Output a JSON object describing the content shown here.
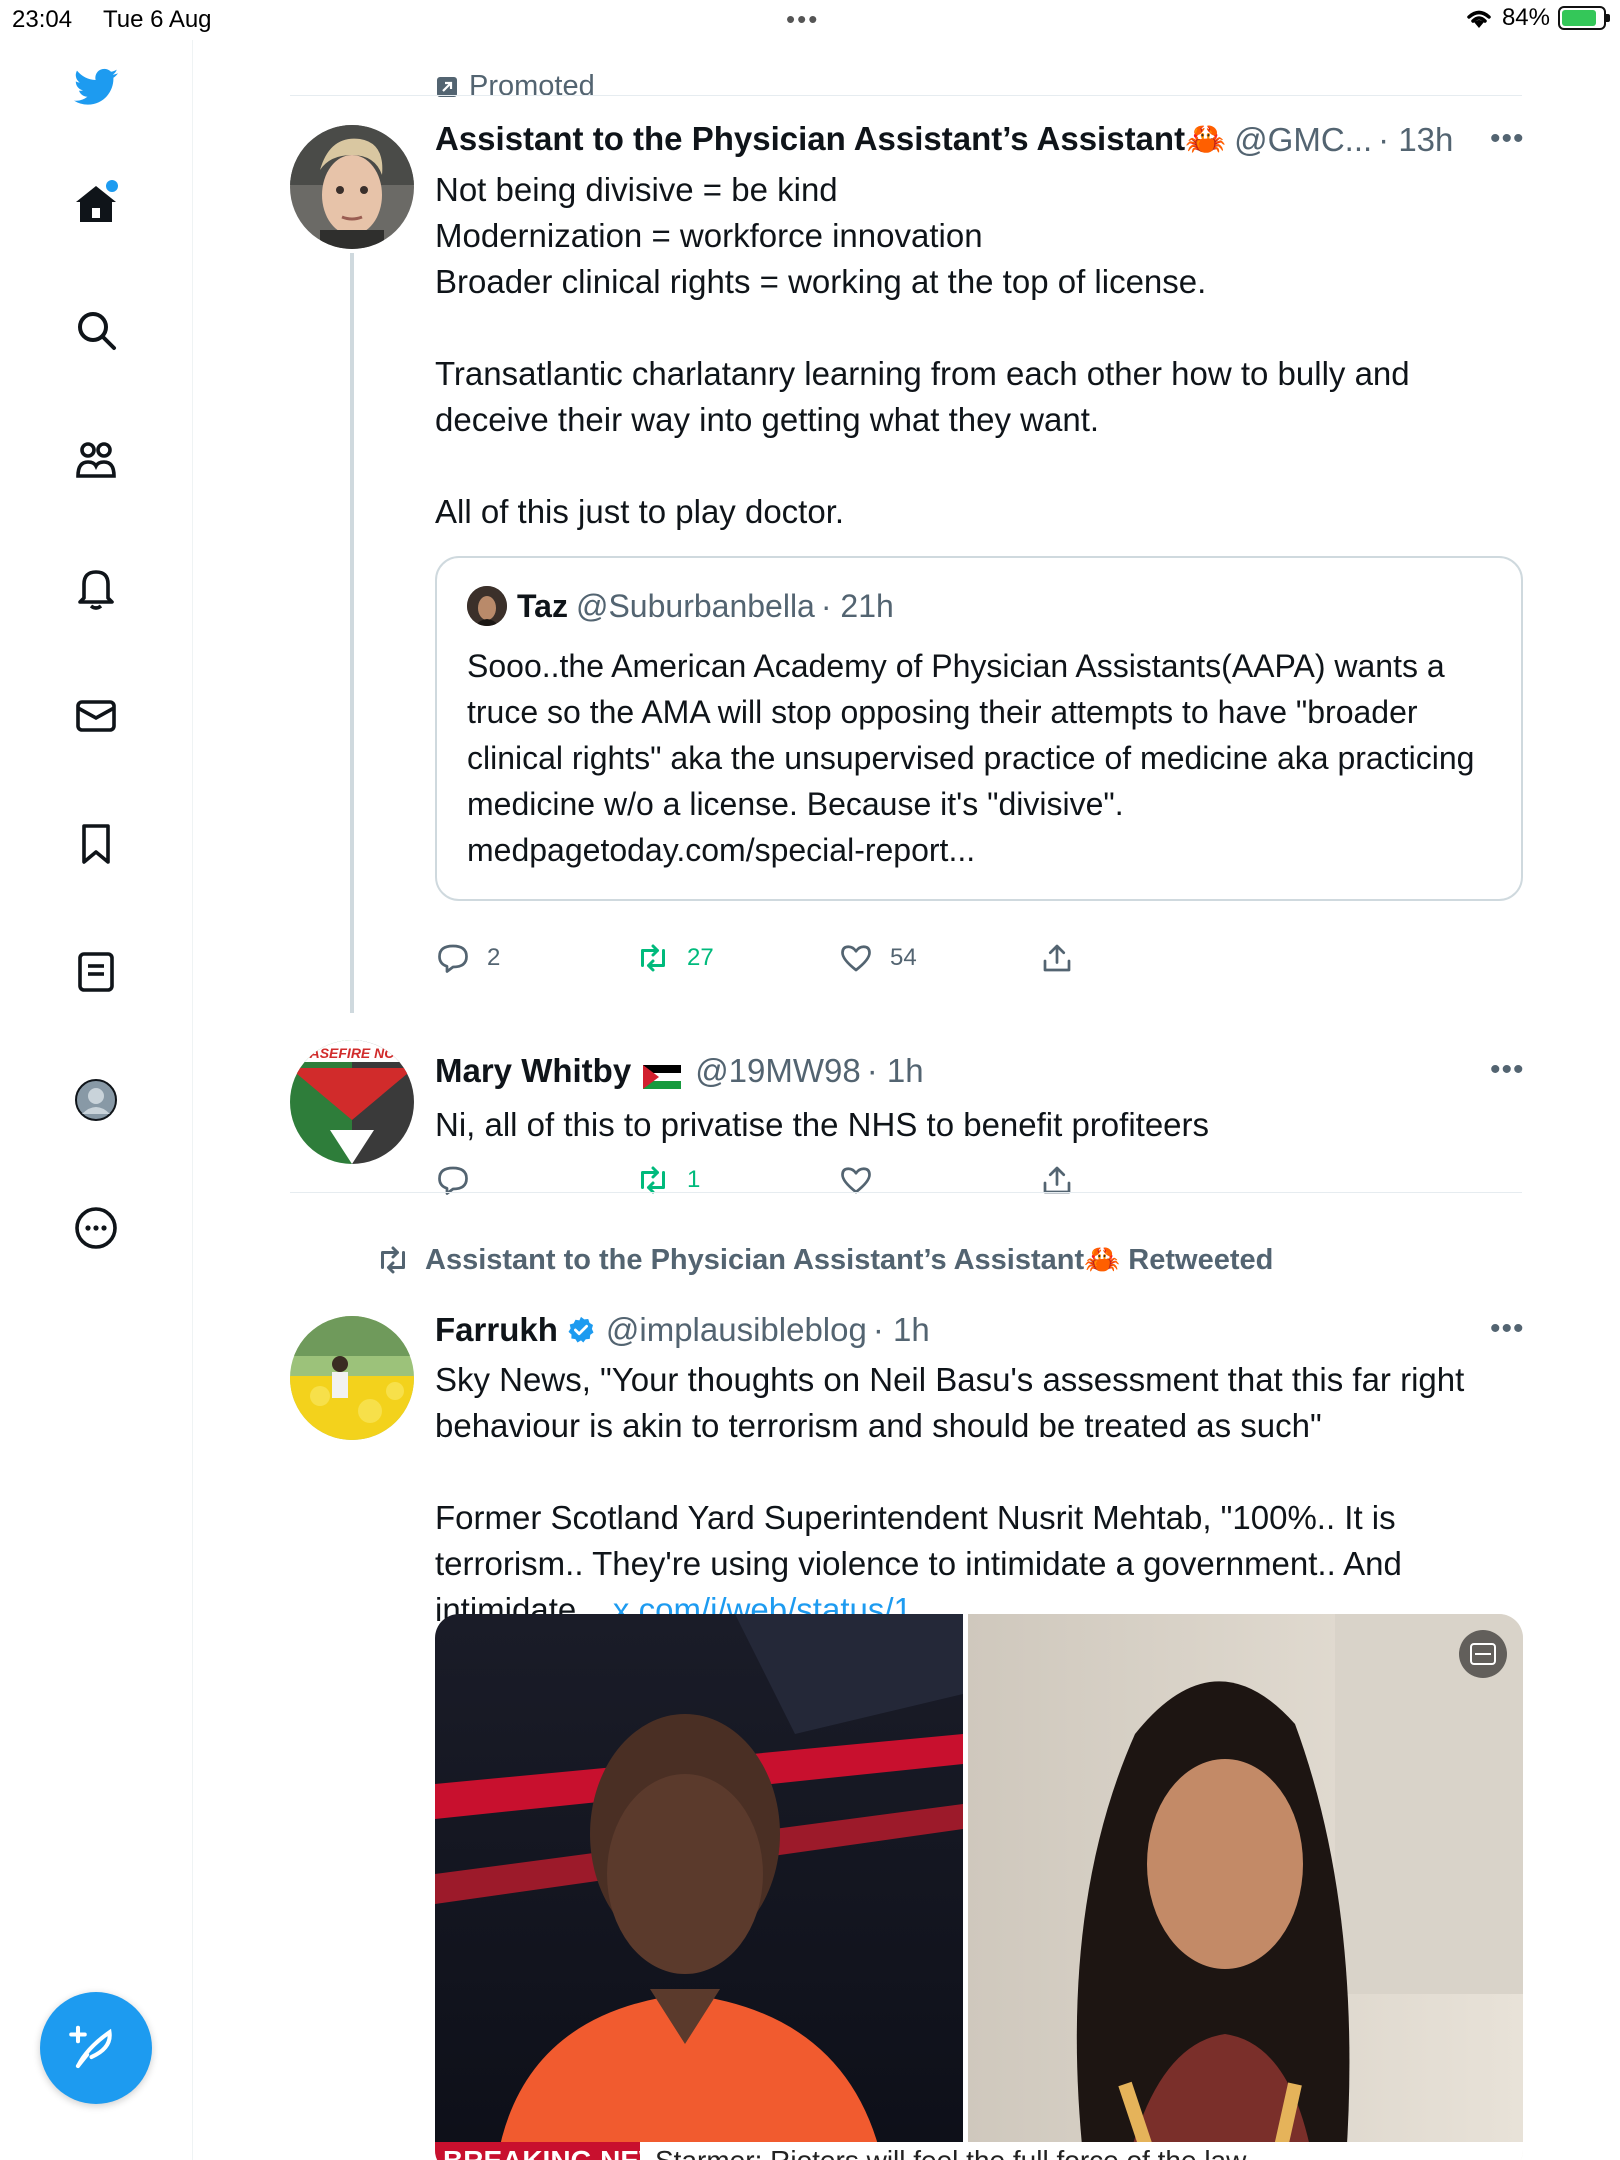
{
  "status_bar": {
    "time": "23:04",
    "date": "Tue 6 Aug",
    "battery": "84%",
    "battery_level": 0.84
  },
  "sidebar": {
    "nav": [
      "twitter-logo",
      "home",
      "explore",
      "communities",
      "notifications",
      "messages",
      "bookmarks",
      "lists",
      "profile",
      "more"
    ]
  },
  "feed": {
    "promoted_label": "Promoted",
    "tweet1": {
      "name": "Assistant to the Physician Assistant’s Assistant🦀",
      "handle": "@GMC...",
      "time": "· 13h",
      "text": "Not being divisive = be kind\nModernization = workforce innovation\nBroader clinical rights = working at the top of license.\n\nTransatlantic charlatanry learning from each other how to bully and deceive their way into getting what they want.\n\nAll of this just to play doctor.",
      "quote": {
        "name": "Taz",
        "handle": "@Suburbanbella",
        "time": "· 21h",
        "text": "Sooo..the American Academy of Physician Assistants(AAPA) wants a truce so the AMA will stop opposing their attempts to have \"broader clinical rights\" aka the unsupervised practice of medicine aka practicing medicine w/o a license. Because it's \"divisive\". medpagetoday.com/special-report..."
      },
      "replies": "2",
      "retweets": "27",
      "likes": "54"
    },
    "tweet2": {
      "name": "Mary Whitby",
      "handle": "@19MW98",
      "time": "· 1h",
      "avatar_text": "ASEFIRE NC",
      "text": "Ni, all of this to privatise the NHS to benefit profiteers",
      "retweets": "1"
    },
    "tweet3": {
      "retweeted_by": "Assistant to the Physician Assistant’s Assistant🦀 Retweeted",
      "name": "Farrukh",
      "handle": "@implausibleblog",
      "time": "· 1h",
      "text_part1": "Sky News, \"Your thoughts on Neil Basu's assessment that this far right behaviour is akin to terrorism and should be treated as such\"\n\nFormer Scotland Yard Superintendent Nusrit Mehtab, \"100%.. It is terrorism.. They're using violence to intimidate a government.. And intimidate... ",
      "link": "x.com/i/web/status/1...",
      "media_caption_left": "BREAKING NEWS",
      "media_caption_right": "Starmer: Rioters will feel the full force of the law"
    }
  },
  "colors": {
    "accent": "#1d9bf0",
    "retweet": "#00ba7c",
    "secondary_text": "#536471"
  }
}
